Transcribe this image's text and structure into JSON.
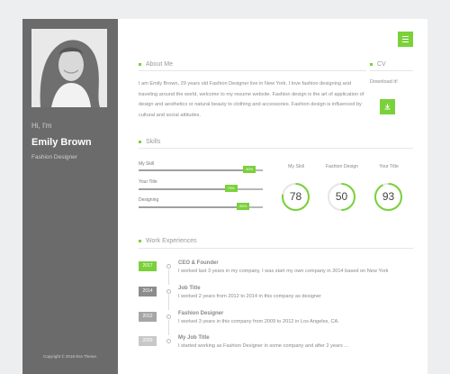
{
  "profile": {
    "greeting": "Hi, I'm",
    "name": "Emily Brown",
    "role": "Fashion Designer",
    "copyright": "Copyright © 2018 Ikra Theme."
  },
  "about": {
    "title": "About Me",
    "text": "I am Emily Brown, 29 years old Fashion Designer live in New York. I love fashion designing and traveling around the world, welcome to my resume website. Fashion design is the art of application of design and aesthetics or natural beauty to clothing and accessories. Fashion design is influenced by cultural and social attitudes."
  },
  "cv": {
    "title": "CV",
    "download_label": "Download it!"
  },
  "skills": {
    "title": "Skills",
    "bars": [
      {
        "label": "My Skill",
        "percent": 90,
        "tag": "90%"
      },
      {
        "label": "Your Title",
        "percent": 75,
        "tag": "75%"
      },
      {
        "label": "Designing",
        "percent": 85,
        "tag": "85%"
      }
    ],
    "circles": [
      {
        "label": "My Skill",
        "value": 78
      },
      {
        "label": "Fashion Design",
        "value": 50
      },
      {
        "label": "Your Title",
        "value": 93
      }
    ]
  },
  "experience": {
    "title": "Work Experiences",
    "items": [
      {
        "year": "2017",
        "title": "CEO & Founder",
        "desc": "I worked last 3 years in my company, I was start my own company in 2014 based on New York",
        "color": "#7ad13a"
      },
      {
        "year": "2014",
        "title": "Job Title",
        "desc": "I worked 2 years from 2012 to 2014 in this company as designer",
        "color": "#8c8c8c"
      },
      {
        "year": "2012",
        "title": "Fashion Designer",
        "desc": "I worked 3 years in this company from 2009 to 2012 in Los Angeles, CA.",
        "color": "#a6a6a6"
      },
      {
        "year": "2009",
        "title": "My Job Title",
        "desc": "I started working as Fashion Designer in some company and after 2 years ...",
        "color": "#c8c8c8"
      }
    ]
  },
  "colors": {
    "accent": "#7ad13a",
    "sidebar": "#6b6b6b"
  },
  "icons": {
    "menu": "menu-icon",
    "download": "download-icon"
  }
}
